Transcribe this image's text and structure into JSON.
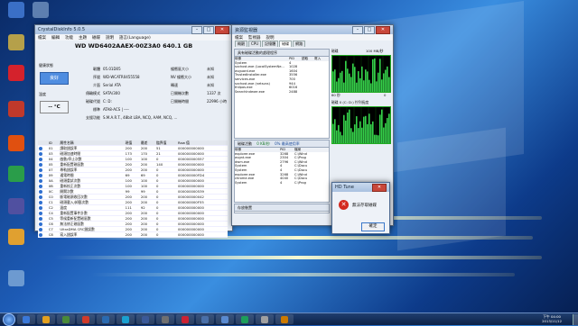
{
  "desktop": {
    "icons": [
      {
        "label": "",
        "color": "#3a6fc6"
      },
      {
        "label": "",
        "color": "#5d7fb0"
      },
      {
        "label": "",
        "color": "#b5a04a"
      },
      {
        "label": "",
        "color": "#d4222c"
      },
      {
        "label": "",
        "color": "#c0392b"
      },
      {
        "label": "",
        "color": "#e05010"
      },
      {
        "label": "",
        "color": "#2a9d4a"
      },
      {
        "label": "",
        "color": "#5050a0"
      },
      {
        "label": "",
        "color": "#e0a030"
      },
      {
        "label": "",
        "color": "#6d9ad0"
      }
    ]
  },
  "cdi": {
    "title": "CrystalDiskInfo 5.0.5",
    "menu": [
      "檔案",
      "編輯",
      "功能",
      "主題",
      "磁碟",
      "說明",
      "語言(Language)"
    ],
    "drive_title": "WD WD6402AAEX-00Z3A0  640.1 GB",
    "health_label": "健康狀態",
    "health_value": "良好",
    "temp_label": "溫度",
    "temp_value": "-- °C",
    "fields_left": [
      {
        "k": "韌體",
        "v": "05.01D05"
      },
      {
        "k": "序號",
        "v": "WD-WCATR0455558"
      },
      {
        "k": "介面",
        "v": "Serial ATA"
      },
      {
        "k": "傳輸模式",
        "v": "SATA/300"
      },
      {
        "k": "磁碟代號",
        "v": "C: D:"
      },
      {
        "k": "標準",
        "v": "ATA8-ACS | ----"
      },
      {
        "k": "支援功能",
        "v": "S.M.A.R.T., 48bit LBA, NCQ, AAM, NCQ, ..."
      }
    ],
    "fields_right": [
      {
        "k": "緩衝區大小",
        "v": "未知"
      },
      {
        "k": "NV 緩衝大小",
        "v": "未知"
      },
      {
        "k": "轉速",
        "v": "未知"
      },
      {
        "k": "已開機次數",
        "v": "1337 次"
      },
      {
        "k": "已開機時間",
        "v": "22996 小時"
      }
    ],
    "attr_headers": [
      "ID",
      "屬性名稱",
      "現值",
      "最差",
      "臨界值",
      "Raw 值"
    ],
    "attributes": [
      [
        "01",
        "讀取錯誤率",
        "200",
        "200",
        "51",
        "000000000000"
      ],
      [
        "03",
        "磁頭加速時間",
        "173",
        "170",
        "21",
        "000000000000"
      ],
      [
        "04",
        "啟動/停止次數",
        "100",
        "100",
        "0",
        "000000000557"
      ],
      [
        "05",
        "重新配置磁區數",
        "200",
        "200",
        "140",
        "000000000000"
      ],
      [
        "07",
        "尋軌錯誤率",
        "200",
        "200",
        "0",
        "000000000000"
      ],
      [
        "09",
        "通電時間",
        "69",
        "69",
        "0",
        "000000000FD4"
      ],
      [
        "0A",
        "磁頭重試次數",
        "100",
        "100",
        "0",
        "000000000000"
      ],
      [
        "0B",
        "重新校正次數",
        "100",
        "100",
        "0",
        "000000000000"
      ],
      [
        "0C",
        "開關次數",
        "99",
        "99",
        "0",
        "000000000539"
      ],
      [
        "C0",
        "斷電磁頭收回次數",
        "200",
        "200",
        "0",
        "000000000042"
      ],
      [
        "C1",
        "磁頭載入/卸載次數",
        "200",
        "200",
        "0",
        "000000000F55"
      ],
      [
        "C2",
        "溫度",
        "111",
        "92",
        "0",
        "000000000000"
      ],
      [
        "C4",
        "重新配置事件計數",
        "200",
        "200",
        "0",
        "000000000000"
      ],
      [
        "C5",
        "等候重新配置磁區數",
        "200",
        "200",
        "0",
        "000000000000"
      ],
      [
        "C6",
        "無法修正磁區數",
        "200",
        "200",
        "0",
        "000000000000"
      ],
      [
        "C7",
        "UltraDMA CRC錯誤數",
        "200",
        "200",
        "0",
        "000000000000"
      ],
      [
        "C8",
        "寫入錯誤率",
        "200",
        "200",
        "0",
        "000000000000"
      ]
    ]
  },
  "taskmgr": {
    "title": "資源監視器",
    "menu": [
      "檔案",
      "監視器",
      "說明"
    ],
    "tabs": [
      "概觀",
      "CPU",
      "記憶體",
      "磁碟",
      "網路"
    ],
    "active_tab": "磁碟",
    "section1_title": "具有磁碟活動的處理程序",
    "processes": [
      [
        "映像",
        "PID",
        "讀取",
        "寫入"
      ],
      [
        "System",
        "4",
        "",
        ""
      ],
      [
        "svchost.exe (LocalSystemNe...",
        "1028",
        "",
        ""
      ],
      [
        "avguard.exe",
        "1604",
        "",
        ""
      ],
      [
        "TrustedInstaller.exe",
        "3556",
        "",
        ""
      ],
      [
        "services.exe",
        "700",
        "",
        ""
      ],
      [
        "svchost.exe (netsvcs)",
        "944",
        "",
        ""
      ],
      [
        "thilpos.exe",
        "6016",
        "",
        ""
      ],
      [
        "SearchIndexer.exe",
        "2488",
        "",
        ""
      ]
    ],
    "section2_title": "磁碟活動",
    "section2_rate": "0 KB/秒",
    "section2_extra": "0% 最高使用率",
    "files": [
      [
        "映像",
        "PID",
        "檔案"
      ],
      [
        "explorer.exe",
        "3268",
        "C:\\Wind"
      ],
      [
        "avgnt.exe",
        "2304",
        "C:\\Prog"
      ],
      [
        "dwm.exe",
        "2796",
        "C:\\Wind"
      ],
      [
        "System",
        "4",
        "C:\\Docu"
      ],
      [
        "System",
        "4",
        "C:\\Docu"
      ],
      [
        "explorer.exe",
        "3268",
        "C:\\Wind"
      ],
      [
        "chrome.exe",
        "4040",
        "C:\\Docu"
      ],
      [
        "System",
        "4",
        "C:\\Prog"
      ]
    ],
    "section3_title": "存放裝置",
    "graph1_label": "磁碟",
    "graph1_rate": "100 MB/秒",
    "graph1_bottom": "60 秒",
    "graph1_pct": "0",
    "graph2_label": "磁碟 0 (C: D:) 佇列長度",
    "graph2_value": "10"
  },
  "dialog": {
    "title": "HD Tune",
    "message": "無法存取磁碟",
    "ok_label": "確定"
  },
  "taskbar": {
    "clock_time": "下午 04:00",
    "clock_date": "2013/11/12",
    "items": [
      "#3a78d8",
      "#e2a020",
      "#4a8a3a",
      "#d03b2a",
      "#2a6ab0",
      "#1aa0d0",
      "#3b5998",
      "#707070",
      "#c23",
      "#4a6fa8",
      "#5a8ad0",
      "#1d9e5a",
      "#a0a0a0",
      "#cc7a00"
    ]
  }
}
